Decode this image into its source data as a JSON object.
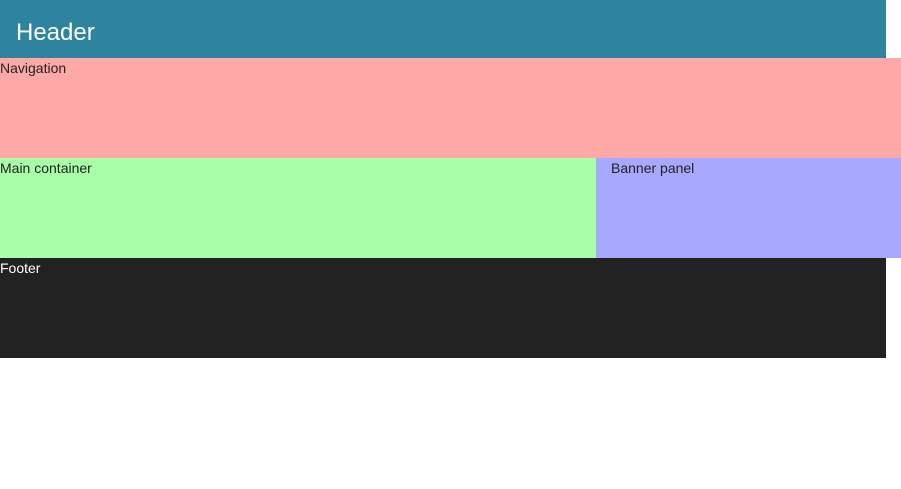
{
  "header": {
    "title": "Header"
  },
  "navigation": {
    "label": "Navigation"
  },
  "main": {
    "label": "Main container"
  },
  "banner": {
    "label": "Banner panel"
  },
  "footer": {
    "label": "Footer"
  },
  "colors": {
    "header_bg": "#2e839f",
    "navigation_bg": "#ffa8a8",
    "main_bg": "#a8ffa8",
    "banner_bg": "#a8a8ff",
    "footer_bg": "#222222"
  }
}
